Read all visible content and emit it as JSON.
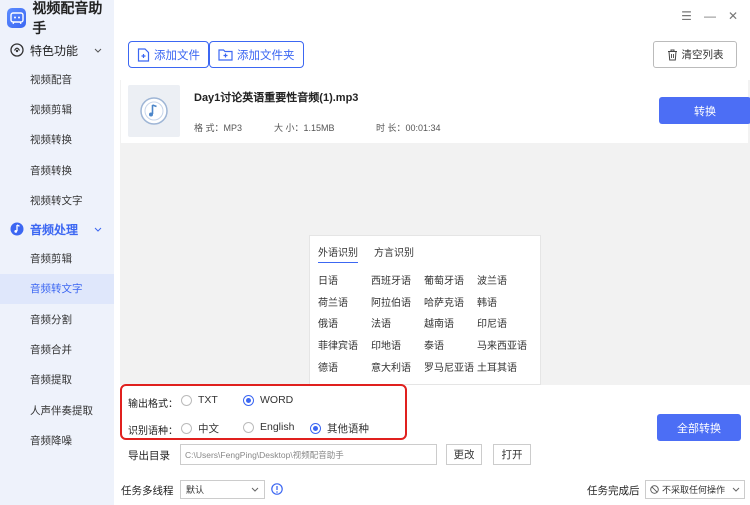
{
  "app": {
    "title": "视频配音助手",
    "logo_icon": "app-logo-icon"
  },
  "sidebar": {
    "section1": {
      "label": "特色功能",
      "icon": "feature-icon"
    },
    "section1_items": [
      "视频配音",
      "视频剪辑",
      "视频转换",
      "音频转换",
      "视频转文字"
    ],
    "section2": {
      "label": "音频处理",
      "icon": "audio-icon"
    },
    "section2_items": [
      "音频剪辑",
      "音频转文字",
      "音频分割",
      "音频合并",
      "音频提取",
      "人声伴奏提取",
      "音频降噪"
    ],
    "selected": "音频转文字"
  },
  "toolbar": {
    "add_file": "添加文件",
    "add_folder": "添加文件夹",
    "clear_list": "清空列表"
  },
  "file": {
    "name": "Day1讨论英语重要性音频(1).mp3",
    "format_label": "格 式：MP3",
    "size_label": "大 小：1.15MB",
    "duration_label": "时 长：00:01:34",
    "convert": "转换"
  },
  "language_panel": {
    "tabs": [
      "外语识别",
      "方言识别"
    ],
    "active_tab": "外语识别",
    "languages": [
      "日语",
      "西班牙语",
      "葡萄牙语",
      "波兰语",
      "荷兰语",
      "阿拉伯语",
      "哈萨克语",
      "韩语",
      "俄语",
      "法语",
      "越南语",
      "印尼语",
      "菲律宾语",
      "印地语",
      "泰语",
      "马来西亚语",
      "德语",
      "意大利语",
      "罗马尼亚语",
      "土耳其语"
    ]
  },
  "output": {
    "format_label": "输出格式：",
    "format_options": [
      "TXT",
      "WORD"
    ],
    "format_selected": "WORD",
    "lang_label": "识别语种：",
    "lang_options": [
      "中文",
      "English",
      "其他语种"
    ],
    "lang_selected": "其他语种"
  },
  "all_convert": "全部转换",
  "export": {
    "label": "导出目录",
    "path": "C:\\Users\\FengPing\\Desktop\\视频配音助手",
    "change": "更改",
    "open": "打开"
  },
  "task": {
    "label": "任务多线程",
    "value": "默认"
  },
  "after": {
    "label": "任务完成后",
    "value": "不采取任何操作"
  },
  "colors": {
    "accent": "#3c67f2",
    "highlight_box": "#e0201e",
    "sidebar_bg": "#eef2fb"
  }
}
